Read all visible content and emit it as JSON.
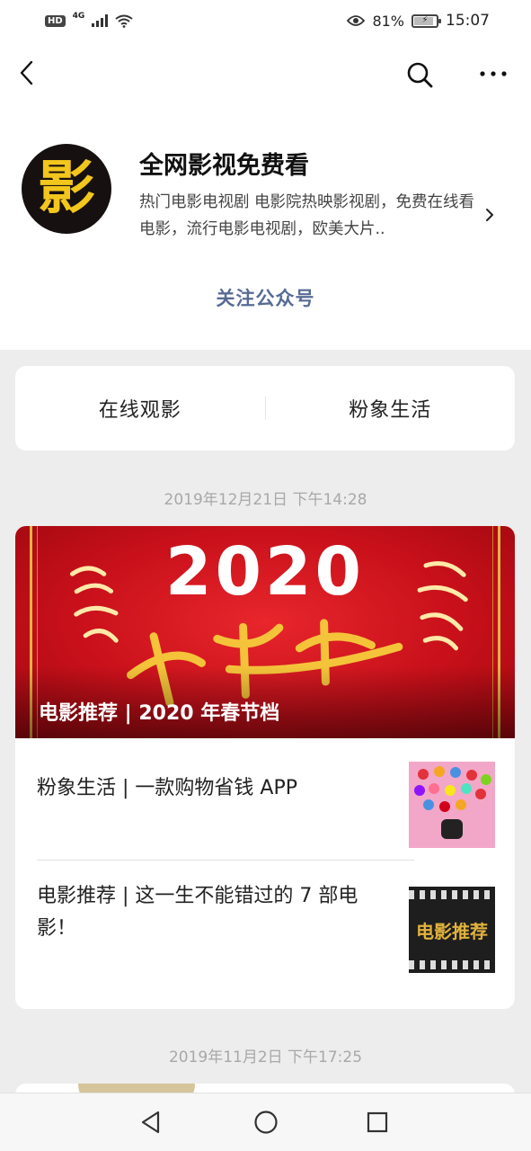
{
  "status_bar": {
    "hd": "HD",
    "network": "4G",
    "battery": "81%",
    "time": "15:07"
  },
  "nav": {
    "back_icon": "chevron-left-icon",
    "search_icon": "search-icon",
    "more_icon": "more-icon"
  },
  "profile": {
    "avatar_char": "影",
    "name": "全网影视免费看",
    "description": "热门电影电视剧 电影院热映影视剧，免费在线看电影，流行电影电视剧，欧美大片..",
    "follow_label": "关注公众号"
  },
  "menu": {
    "items": [
      {
        "label": "在线观影"
      },
      {
        "label": "粉象生活"
      }
    ]
  },
  "messages": [
    {
      "date": "2019年12月21日 下午14:28",
      "cover": {
        "year": "2020",
        "title": "电影推荐 | 2020 年春节档"
      },
      "sub_articles": [
        {
          "title": "粉象生活 | 一款购物省钱 APP"
        },
        {
          "title": "电影推荐 | 这一生不能错过的 7 部电影！",
          "thumb_text": "电影推荐"
        }
      ]
    },
    {
      "date": "2019年11月2日 下午17:25"
    }
  ],
  "colors": {
    "link": "#576b95",
    "cover_red": "#c8101a",
    "gold": "#f2c61d"
  }
}
